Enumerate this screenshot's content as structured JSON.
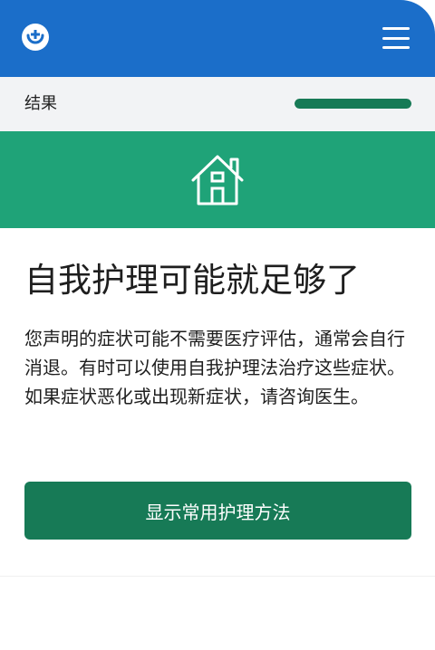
{
  "header": {
    "logo_icon": "medical-logo-icon",
    "menu_icon": "hamburger-menu-icon",
    "color": "#1b6ec9"
  },
  "progress": {
    "label": "结果",
    "value": 1.0,
    "color": "#177a56"
  },
  "banner": {
    "icon": "home-icon",
    "color": "#1fa378"
  },
  "main": {
    "title": "自我护理可能就足够了",
    "description": "您声明的症状可能不需要医疗评估，通常会自行消退。有时可以使用自我护理法治疗这些症状。如果症状恶化或出现新症状，请咨询医生。",
    "button_label": "显示常用护理方法"
  }
}
